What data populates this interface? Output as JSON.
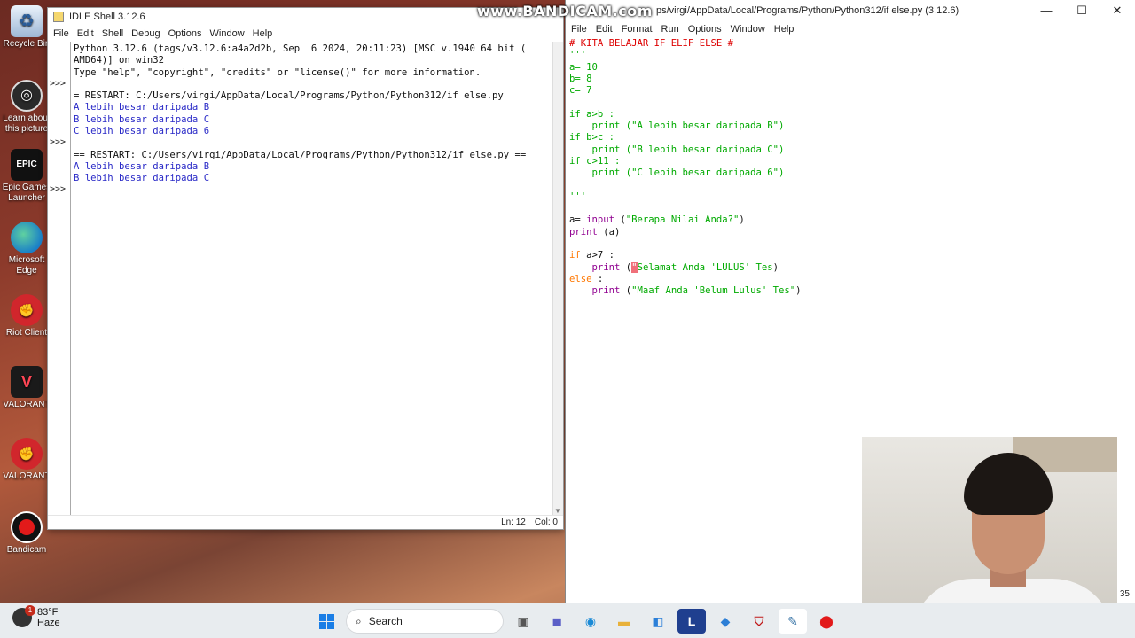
{
  "desktop": {
    "icons": [
      {
        "label": "Recycle Bin",
        "icon": "recycle-bin-icon"
      },
      {
        "label": "Learn about this picture",
        "icon": "camera-icon"
      },
      {
        "label": "Epic Games Launcher",
        "icon": "epic-games-icon"
      },
      {
        "label": "Microsoft Edge",
        "icon": "edge-icon"
      },
      {
        "label": "Riot Client",
        "icon": "riot-icon"
      },
      {
        "label": "VALORANT",
        "icon": "valorant-icon"
      },
      {
        "label": "VALORANT",
        "icon": "riot-icon"
      },
      {
        "label": "Bandicam",
        "icon": "bandicam-icon"
      }
    ],
    "epic_icon_text": "EPIC"
  },
  "watermark": "www.BANDICAM.com",
  "shell": {
    "title": "IDLE Shell 3.12.6",
    "menu": [
      "File",
      "Edit",
      "Shell",
      "Debug",
      "Options",
      "Window",
      "Help"
    ],
    "prompt": ">>>",
    "lines": [
      {
        "text": "Python 3.12.6 (tags/v3.12.6:a4a2d2b, Sep  6 2024, 20:11:23) [MSC v.1940 64 bit (",
        "kind": "std"
      },
      {
        "text": "AMD64)] on win32",
        "kind": "std"
      },
      {
        "text": "Type \"help\", \"copyright\", \"credits\" or \"license()\" for more information.",
        "kind": "std"
      },
      {
        "text": "",
        "kind": "std"
      },
      {
        "text": "= RESTART: C:/Users/virgi/AppData/Local/Programs/Python/Python312/if else.py",
        "kind": "std"
      },
      {
        "text": "A lebih besar daripada B",
        "kind": "out"
      },
      {
        "text": "B lebih besar daripada C",
        "kind": "out"
      },
      {
        "text": "C lebih besar daripada 6",
        "kind": "out"
      },
      {
        "text": "",
        "kind": "std"
      },
      {
        "text": "== RESTART: C:/Users/virgi/AppData/Local/Programs/Python/Python312/if else.py ==",
        "kind": "std"
      },
      {
        "text": "A lebih besar daripada B",
        "kind": "out"
      },
      {
        "text": "B lebih besar daripada C",
        "kind": "out"
      }
    ],
    "status": {
      "ln": "Ln: 12",
      "col": "Col: 0"
    }
  },
  "editor": {
    "title": "ps/virgi/AppData/Local/Programs/Python/Python312/if else.py (3.12.6)",
    "menu": [
      "File",
      "Edit",
      "Format",
      "Run",
      "Options",
      "Window",
      "Help"
    ],
    "controls": {
      "minimize": "—",
      "maximize": "☐",
      "close": "✕"
    },
    "line_number": "35"
  },
  "taskbar": {
    "weather_temp": "83°F",
    "weather_desc": "Haze",
    "weather_badge": "1",
    "search_label": "Search",
    "apps": [
      "start",
      "search",
      "widgets-icon",
      "file-explorer-icon",
      "teams-icon",
      "edge-icon",
      "folder-icon",
      "store-icon",
      "l-app-icon",
      "vscode-icon",
      "mcafee-icon",
      "idle-icon",
      "record-icon"
    ]
  }
}
